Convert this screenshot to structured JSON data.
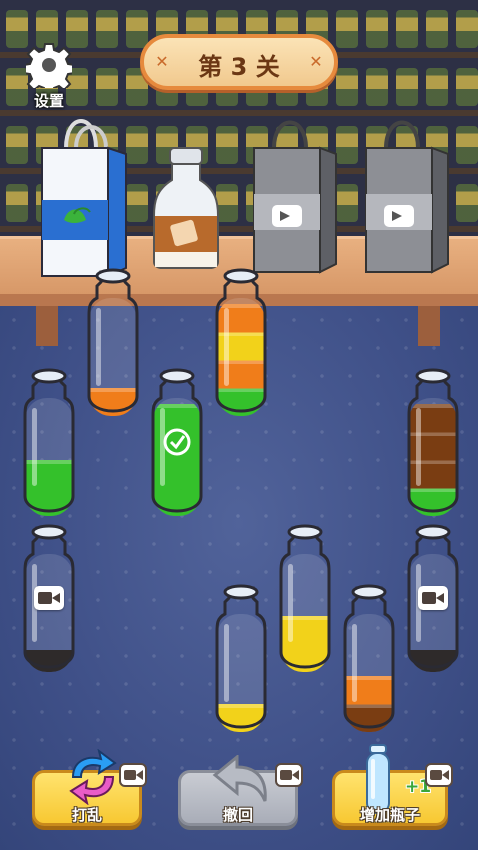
{
  "header": {
    "settings_label": "设置",
    "level_title": "第 3 关"
  },
  "shelf": {
    "items": [
      {
        "kind": "tea-bag",
        "locked": false
      },
      {
        "kind": "milk-tea-bottle",
        "locked": false
      },
      {
        "kind": "gift-bag",
        "locked": true,
        "icon": "video-icon"
      },
      {
        "kind": "gift-bag",
        "locked": true,
        "icon": "video-icon"
      }
    ]
  },
  "colors": {
    "orange": "#f07d1a",
    "yellow": "#f2d21a",
    "green": "#34c12b",
    "brown": "#7a3d12",
    "dark": "#2e2a2a",
    "glass": "#e7eef7"
  },
  "bottles": [
    {
      "id": "b1",
      "layers_bottom_to_top": [
        "orange"
      ],
      "fill_fraction": 0.25,
      "complete": false
    },
    {
      "id": "b2",
      "layers_bottom_to_top": [
        "green",
        "orange",
        "yellow",
        "orange"
      ],
      "fill_fraction": 1.0,
      "complete": false
    },
    {
      "id": "b3",
      "layers_bottom_to_top": [
        "green"
      ],
      "fill_fraction": 0.5,
      "complete": false
    },
    {
      "id": "b4",
      "layers_bottom_to_top": [
        "green"
      ],
      "fill_fraction": 1.0,
      "complete": true,
      "icon": "checkmark-icon"
    },
    {
      "id": "b5",
      "layers_bottom_to_top": [
        "green",
        "brown",
        "brown",
        "brown"
      ],
      "fill_fraction": 1.0,
      "complete": false
    },
    {
      "id": "b6",
      "layers_bottom_to_top": [],
      "locked": true,
      "icon": "video-icon"
    },
    {
      "id": "b7",
      "layers_bottom_to_top": [],
      "locked": true,
      "icon": "video-icon"
    },
    {
      "id": "b8",
      "layers_bottom_to_top": [
        "yellow"
      ],
      "fill_fraction": 0.5,
      "complete": false
    },
    {
      "id": "b9",
      "layers_bottom_to_top": [
        "yellow"
      ],
      "fill_fraction": 0.25,
      "complete": false
    },
    {
      "id": "b10",
      "layers_bottom_to_top": [
        "brown",
        "orange"
      ],
      "fill_fraction": 0.5,
      "complete": false
    }
  ],
  "buttons": {
    "shuffle_label": "打乱",
    "undo_label": "撤回",
    "add_bottle_label": "增加瓶子",
    "add_bottle_badge": "+1"
  }
}
